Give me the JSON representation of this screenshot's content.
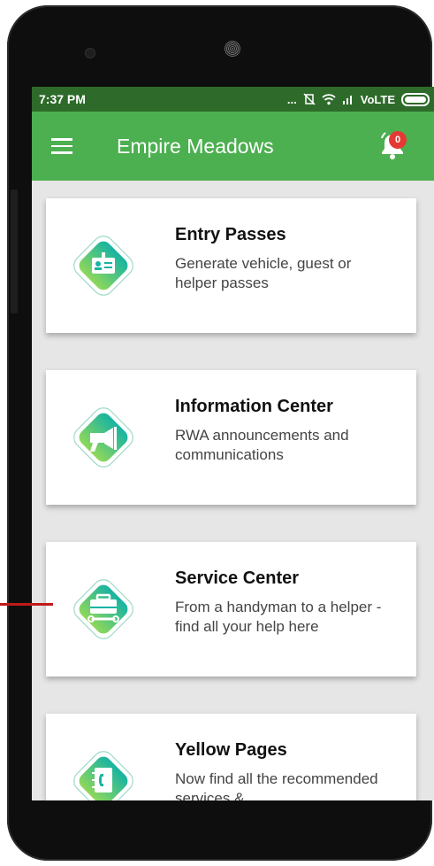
{
  "statusbar": {
    "time": "7:37 PM",
    "dots": "...",
    "network": "VoLTE"
  },
  "appbar": {
    "title": "Empire Meadows",
    "notification_count": "0"
  },
  "cards": [
    {
      "title": "Entry Passes",
      "desc": "Generate vehicle, guest or helper passes",
      "icon": "id-card-icon"
    },
    {
      "title": "Information Center",
      "desc": "RWA announcements and communications",
      "icon": "megaphone-icon"
    },
    {
      "title": "Service Center",
      "desc": "From a handyman to a helper - find all your help here",
      "icon": "toolbox-icon"
    },
    {
      "title": "Yellow Pages",
      "desc": "Now find all the recommended services &",
      "icon": "phonebook-icon"
    }
  ],
  "colors": {
    "appbar": "#4caf50",
    "statusbar": "#2e6b2a",
    "badge": "#e53935",
    "icon_teal": "#17b3a3",
    "icon_green": "#8fd85a"
  }
}
